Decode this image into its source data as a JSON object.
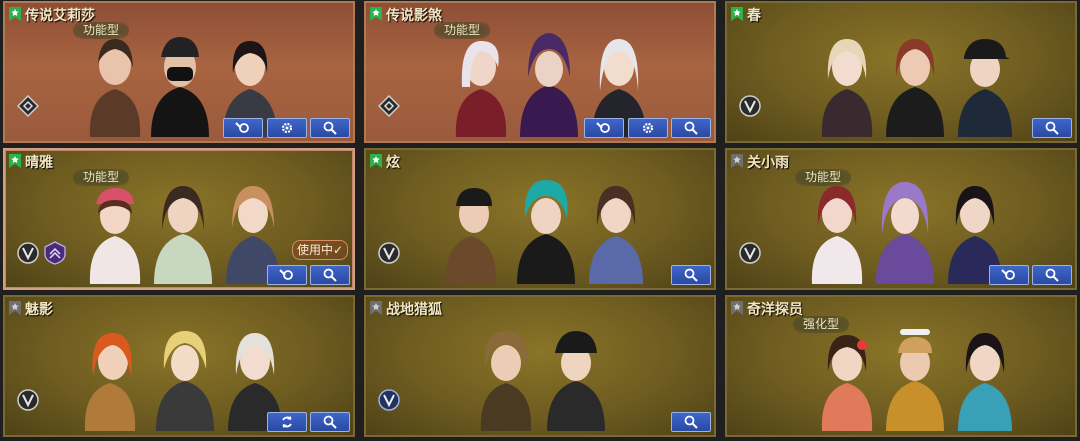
{
  "labels": {
    "functional": "功能型",
    "enhanced": "强化型",
    "in_use": "使用中✓"
  },
  "cards": [
    {
      "name": "传说艾莉莎"
    },
    {
      "name": "传说影煞"
    },
    {
      "name": "春"
    },
    {
      "name": "晴雅"
    },
    {
      "name": "炫"
    },
    {
      "name": "关小雨"
    },
    {
      "name": "魅影"
    },
    {
      "name": "战地猎狐"
    },
    {
      "name": "奇洋探员"
    }
  ],
  "icons": {
    "unlocked_flag": "bookmark-star-green",
    "locked_flag": "bookmark-star-gray",
    "rank_legend": "diamond-rank-icon",
    "rank_v": "v-rank-icon",
    "customize": "wrench-gear-icon",
    "settings": "gear-icon",
    "search": "magnifier-icon",
    "switch": "rotate-icon"
  },
  "colors": {
    "button": "#2f52b0",
    "flag_green": "#2bb34a",
    "flag_gray": "#6e6e6e",
    "title_text": "#f3e6c2"
  }
}
